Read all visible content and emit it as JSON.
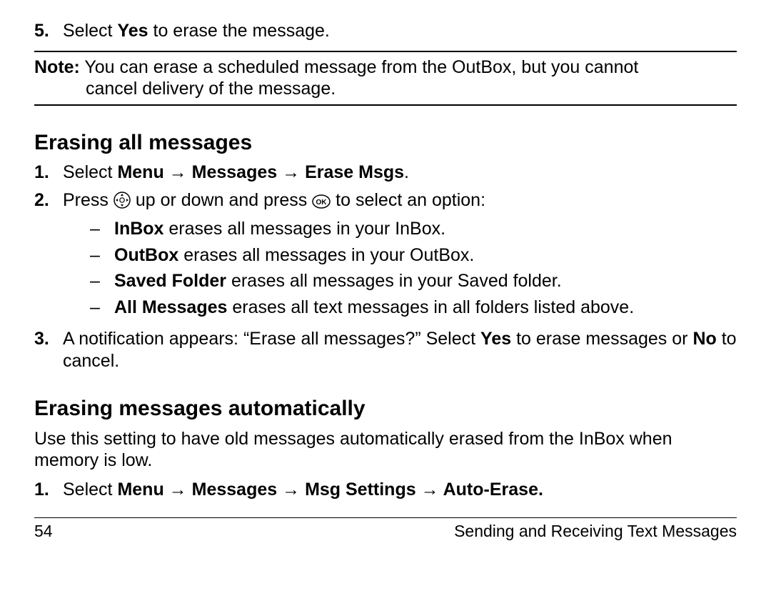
{
  "step5": {
    "num": "5.",
    "pre": "Select ",
    "yes": "Yes",
    "post": " to erase the message."
  },
  "note": {
    "label": "Note:",
    "line1_rest": " You can erase a scheduled message from the OutBox, but you cannot",
    "line2": "cancel delivery of the message."
  },
  "sectionA": {
    "title": "Erasing all messages",
    "s1": {
      "num": "1.",
      "pre": "Select ",
      "menu": "Menu",
      "arrow1": " → ",
      "messages": "Messages",
      "arrow2": " → ",
      "erase": "Erase Msgs",
      "dot": "."
    },
    "s2": {
      "num": "2.",
      "pre": "Press ",
      "mid": " up or down and press ",
      "post": " to select an option:"
    },
    "opts": [
      {
        "term": "InBox",
        "desc": " erases all messages in your InBox."
      },
      {
        "term": "OutBox",
        "desc": " erases all messages in your OutBox."
      },
      {
        "term": "Saved Folder",
        "desc": " erases all messages in your Saved folder."
      },
      {
        "term": "All Messages",
        "desc": " erases all text messages in all folders listed above."
      }
    ],
    "s3": {
      "num": "3.",
      "p1": "A notification appears: “Erase all messages?” Select ",
      "yes": "Yes",
      "p2": " to erase messages or ",
      "no": "No",
      "p3": " to cancel."
    }
  },
  "sectionB": {
    "title": "Erasing messages automatically",
    "intro": "Use this setting to have old messages automatically erased from the InBox when memory is low.",
    "s1": {
      "num": "1.",
      "pre": "Select ",
      "menu": "Menu",
      "a1": " → ",
      "messages": "Messages",
      "a2": " → ",
      "msgset": "Msg Settings",
      "a3": " → ",
      "auto": "Auto-Erase."
    }
  },
  "footer": {
    "page": "54",
    "chapter": "Sending and Receiving Text Messages"
  },
  "dash": "–"
}
